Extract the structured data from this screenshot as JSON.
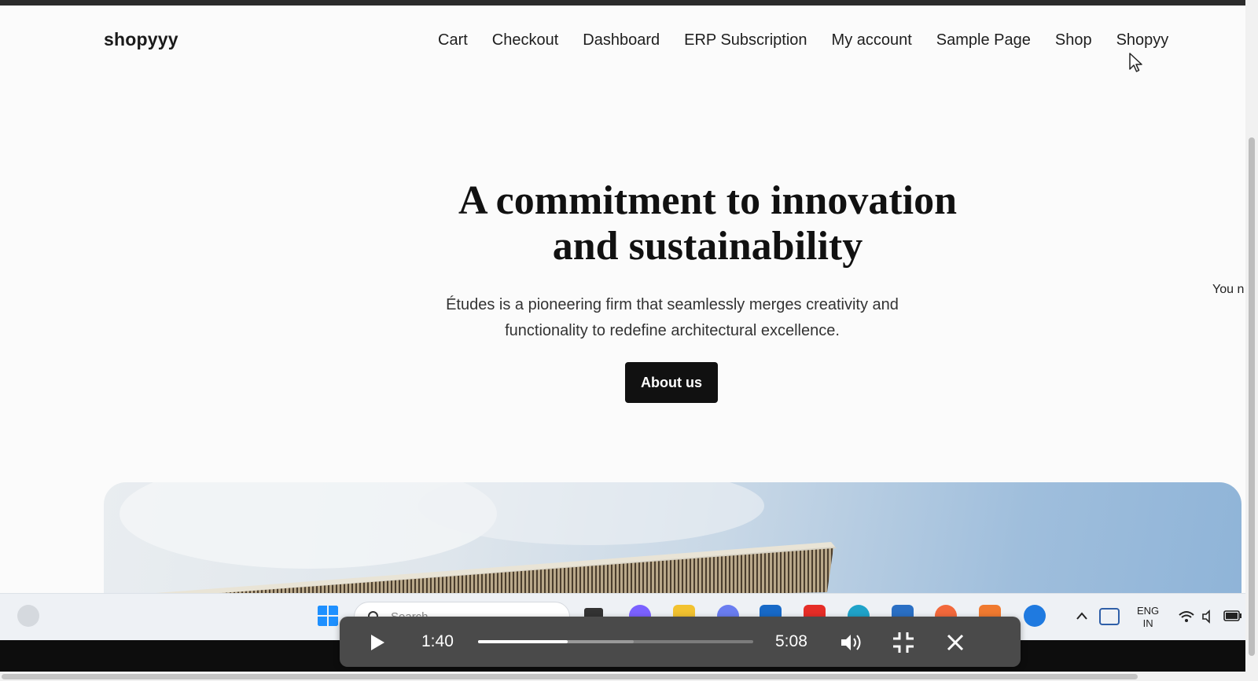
{
  "site": {
    "title": "shopyyy",
    "nav": [
      "Cart",
      "Checkout",
      "Dashboard",
      "ERP Subscription",
      "My account",
      "Sample Page",
      "Shop",
      "Shopyy"
    ]
  },
  "hero": {
    "title_line1": "A commitment to innovation",
    "title_line2": "and sustainability",
    "text_line1": "Études is a pioneering firm that seamlessly merges creativity and",
    "text_line2": "functionality to redefine architectural excellence.",
    "button_label": "About us"
  },
  "side_snippet": "You n",
  "taskbar": {
    "search_placeholder": "Search",
    "language_line1": "ENG",
    "language_line2": "IN"
  },
  "player": {
    "current_time": "1:40",
    "total_time": "5:08",
    "progress_fraction": 0.325,
    "buffered_fraction": 0.565
  },
  "colors": {
    "nav_text": "#1e1e1e",
    "button_bg": "#111111",
    "player_bg": "#4a4a4a"
  }
}
